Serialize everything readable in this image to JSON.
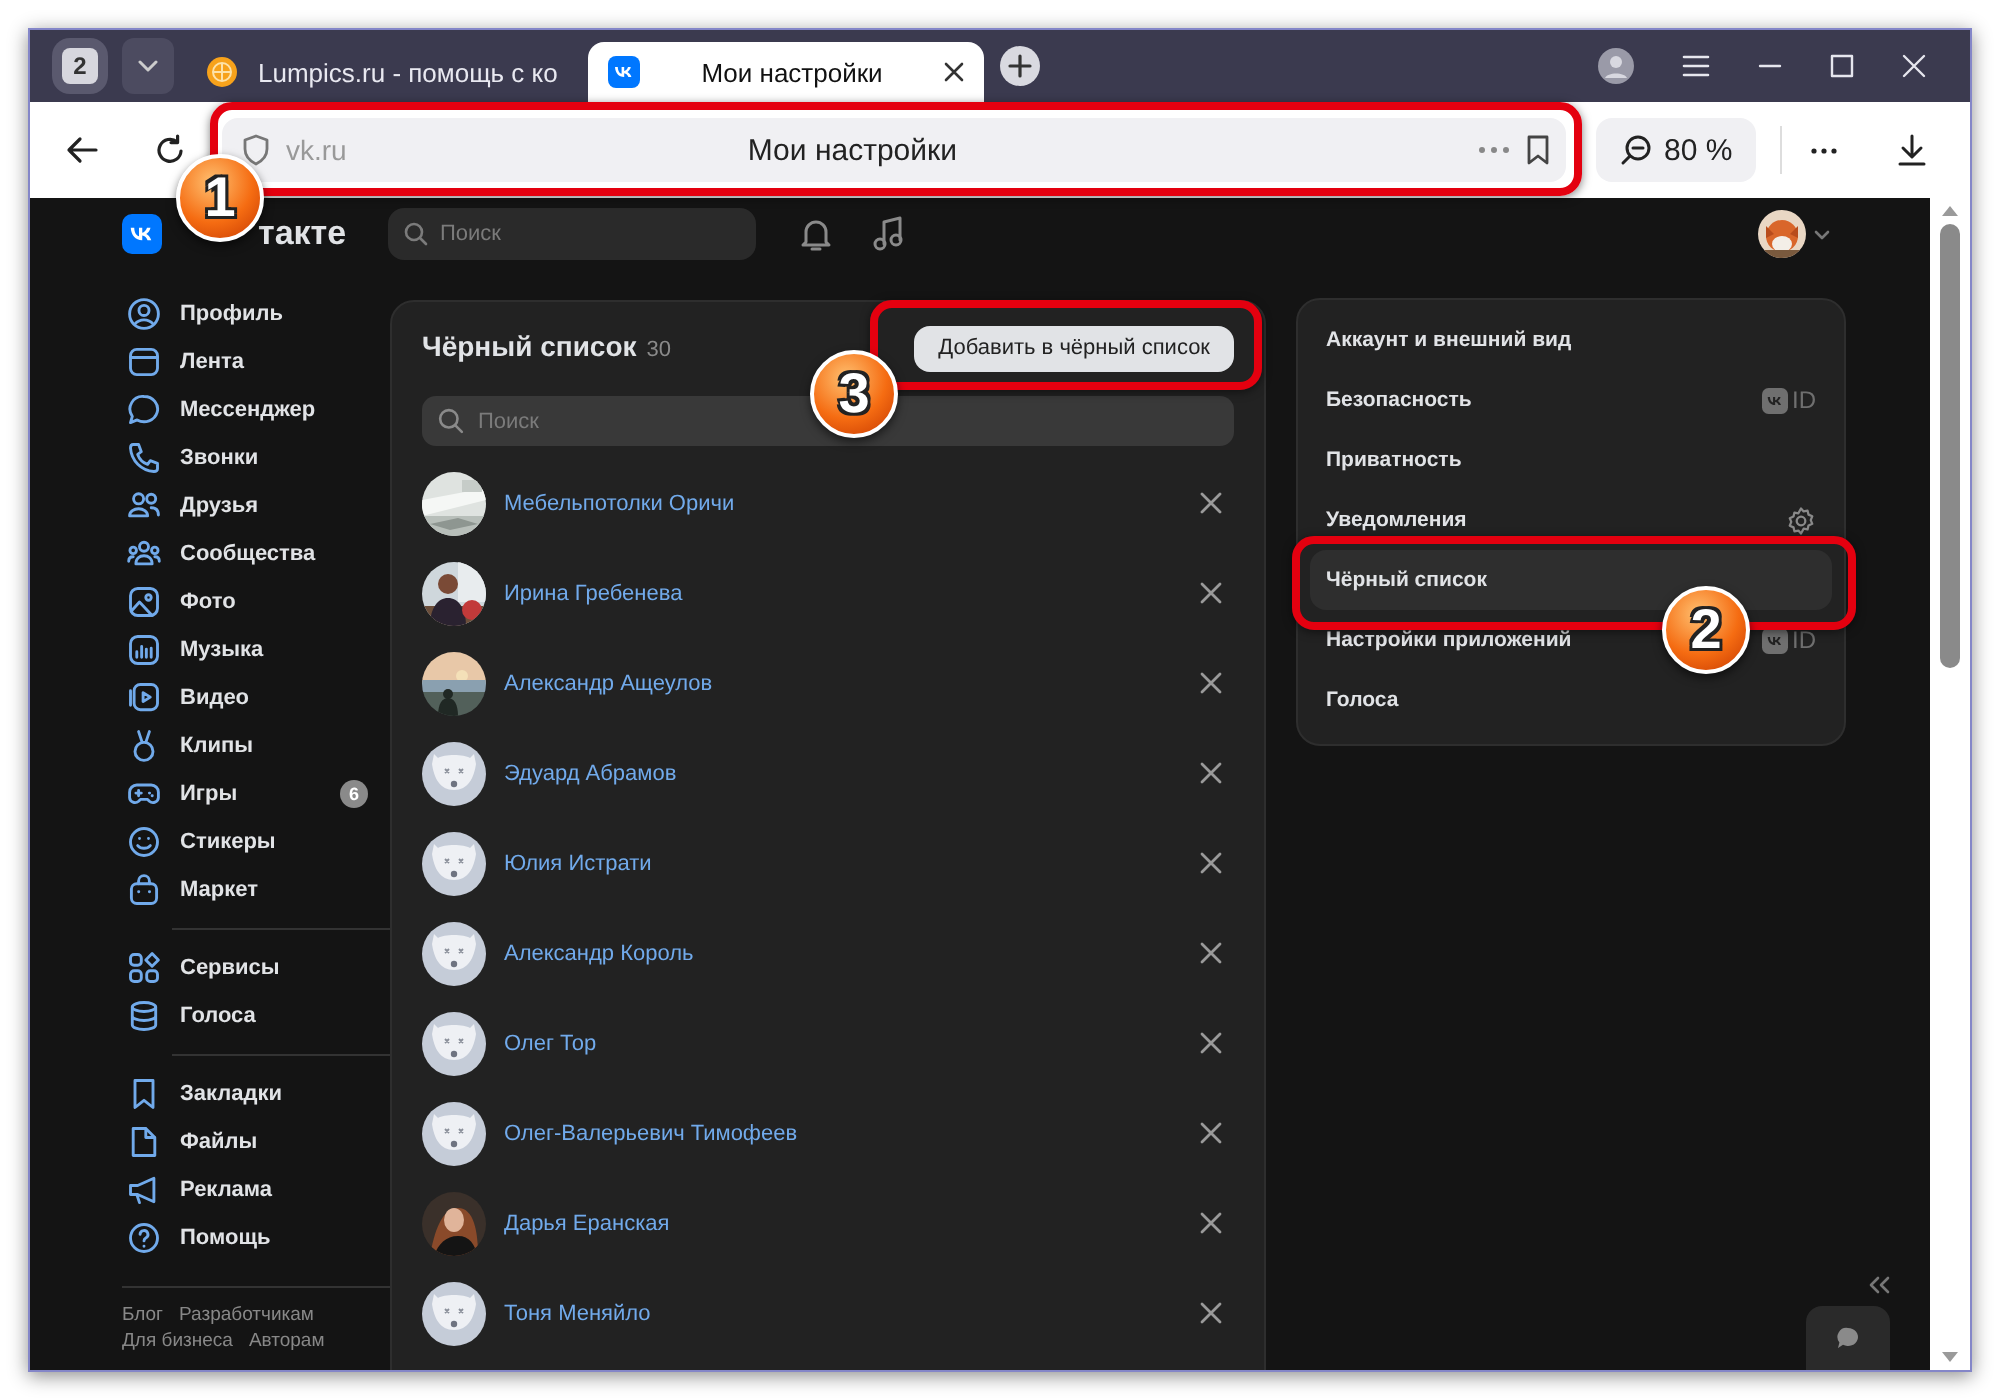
{
  "browser": {
    "tab_count": "2",
    "tabs": [
      {
        "title": "Lumpics.ru - помощь с ко",
        "selected": false
      },
      {
        "title": "Мои настройки",
        "selected": true
      }
    ],
    "address": {
      "domain": "vk.ru",
      "page_title": "Мои настройки"
    },
    "zoom": "80 %"
  },
  "header": {
    "logo": "такте",
    "search_placeholder": "Поиск"
  },
  "nav": {
    "groups": [
      [
        {
          "label": "Профиль"
        },
        {
          "label": "Лента"
        },
        {
          "label": "Мессенджер"
        },
        {
          "label": "Звонки"
        },
        {
          "label": "Друзья"
        },
        {
          "label": "Сообщества"
        },
        {
          "label": "Фото"
        },
        {
          "label": "Музыка"
        },
        {
          "label": "Видео"
        },
        {
          "label": "Клипы"
        },
        {
          "label": "Игры",
          "count": "6"
        },
        {
          "label": "Стикеры"
        },
        {
          "label": "Маркет"
        }
      ],
      [
        {
          "label": "Сервисы"
        },
        {
          "label": "Голоса"
        }
      ],
      [
        {
          "label": "Закладки"
        },
        {
          "label": "Файлы"
        },
        {
          "label": "Реклама"
        },
        {
          "label": "Помощь"
        }
      ]
    ],
    "footer_links": [
      "Блог",
      "Разработчикам",
      "Для бизнеса",
      "Авторам"
    ]
  },
  "blacklist": {
    "title": "Чёрный список",
    "count": "30",
    "add_button": "Добавить в чёрный список",
    "search_placeholder": "Поиск",
    "rows": [
      {
        "name": "Мебельпотолки Оричи"
      },
      {
        "name": "Ирина Гребенева"
      },
      {
        "name": "Александр Ащеулов"
      },
      {
        "name": "Эдуард Абрамов",
        "kind": "default"
      },
      {
        "name": "Юлия Истрати",
        "kind": "default"
      },
      {
        "name": "Александр Король",
        "kind": "default"
      },
      {
        "name": "Олег Тор",
        "kind": "default"
      },
      {
        "name": "Олег-Валерьевич Тимофеев",
        "kind": "default"
      },
      {
        "name": "Дарья Еранская"
      },
      {
        "name": "Тоня Меняйло",
        "kind": "default"
      }
    ]
  },
  "settings_menu": [
    {
      "label": "Аккаунт и внешний вид",
      "selected": false
    },
    {
      "label": "Безопасность",
      "selected": false,
      "badge": {
        "kind": "vkid",
        "text": "ID"
      }
    },
    {
      "label": "Приватность",
      "selected": false
    },
    {
      "label": "Уведомления",
      "selected": false,
      "badge": {
        "kind": "gear"
      }
    },
    {
      "label": "Чёрный список",
      "selected": true
    },
    {
      "label": "Настройки приложений",
      "selected": false,
      "badge": {
        "kind": "vkid",
        "text": "ID"
      }
    },
    {
      "label": "Голоса",
      "selected": false
    }
  ],
  "annotations": [
    {
      "number": "1"
    },
    {
      "number": "2"
    },
    {
      "number": "3"
    }
  ]
}
